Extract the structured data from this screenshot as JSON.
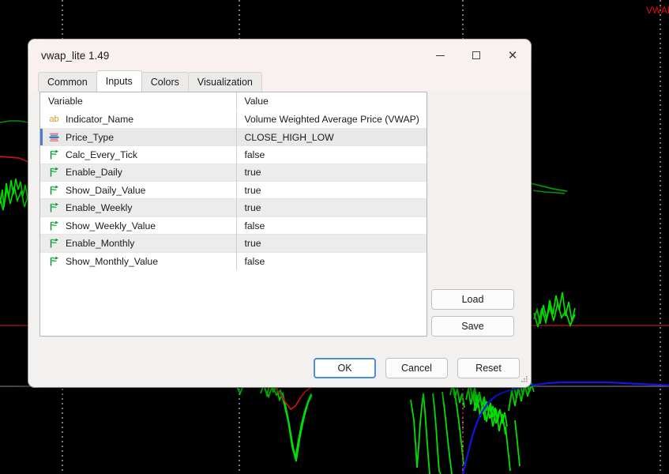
{
  "background": {
    "vwap_label": "VWAP",
    "colors": {
      "bg": "#000000",
      "green": "#00c000",
      "bright_green": "#00e000",
      "red": "#c81414",
      "dark_red": "#7a0d0d",
      "blue": "#1414e6",
      "gridline": "#c8c8c8"
    }
  },
  "dialog": {
    "title": "vwap_lite 1.49",
    "window_controls": [
      {
        "name": "minimize",
        "glyph": "minimize-icon"
      },
      {
        "name": "maximize",
        "glyph": "maximize-icon"
      },
      {
        "name": "close",
        "glyph": "close-icon",
        "label": "✕"
      }
    ],
    "tabs": [
      {
        "label": "Common",
        "active": false
      },
      {
        "label": "Inputs",
        "active": true
      },
      {
        "label": "Colors",
        "active": false
      },
      {
        "label": "Visualization",
        "active": false
      }
    ],
    "table": {
      "headers": {
        "variable": "Variable",
        "value": "Value"
      },
      "rows": [
        {
          "icon": "text-ab-icon",
          "variable": "Indicator_Name",
          "value": "Volume Weighted Average Price (VWAP)",
          "alt": false,
          "selected": false
        },
        {
          "icon": "enum-list-icon",
          "variable": "Price_Type",
          "value": "CLOSE_HIGH_LOW",
          "alt": true,
          "selected": true
        },
        {
          "icon": "bool-flag-icon",
          "variable": "Calc_Every_Tick",
          "value": "false",
          "alt": false,
          "selected": false
        },
        {
          "icon": "bool-flag-icon",
          "variable": "Enable_Daily",
          "value": "true",
          "alt": true,
          "selected": false
        },
        {
          "icon": "bool-flag-icon",
          "variable": "Show_Daily_Value",
          "value": "true",
          "alt": false,
          "selected": false
        },
        {
          "icon": "bool-flag-icon",
          "variable": "Enable_Weekly",
          "value": "true",
          "alt": true,
          "selected": false
        },
        {
          "icon": "bool-flag-icon",
          "variable": "Show_Weekly_Value",
          "value": "false",
          "alt": false,
          "selected": false
        },
        {
          "icon": "bool-flag-icon",
          "variable": "Enable_Monthly",
          "value": "true",
          "alt": true,
          "selected": false
        },
        {
          "icon": "bool-flag-icon",
          "variable": "Show_Monthly_Value",
          "value": "false",
          "alt": false,
          "selected": false
        }
      ]
    },
    "side_buttons": {
      "load": "Load",
      "save": "Save"
    },
    "footer_buttons": {
      "ok": "OK",
      "cancel": "Cancel",
      "reset": "Reset"
    }
  }
}
